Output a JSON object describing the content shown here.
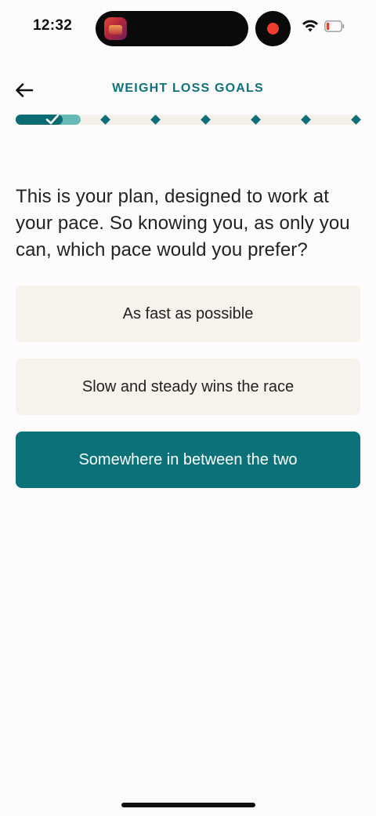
{
  "status_bar": {
    "time": "12:32"
  },
  "header": {
    "title": "WEIGHT LOSS GOALS"
  },
  "progress": {
    "completed_steps": 1,
    "total_steps": 7
  },
  "question": {
    "text": "This is your plan, designed to work at your pace. So knowing you, as only you can, which pace would you prefer?"
  },
  "options": [
    {
      "label": "As fast as possible",
      "selected": false
    },
    {
      "label": "Slow and steady wins the race",
      "selected": false
    },
    {
      "label": "Somewhere in between the two",
      "selected": true
    }
  ],
  "colors": {
    "accent": "#0c727a",
    "accent_light": "#66b9b6",
    "option_bg": "#f6f3ec",
    "recording": "#ee3d2f"
  }
}
